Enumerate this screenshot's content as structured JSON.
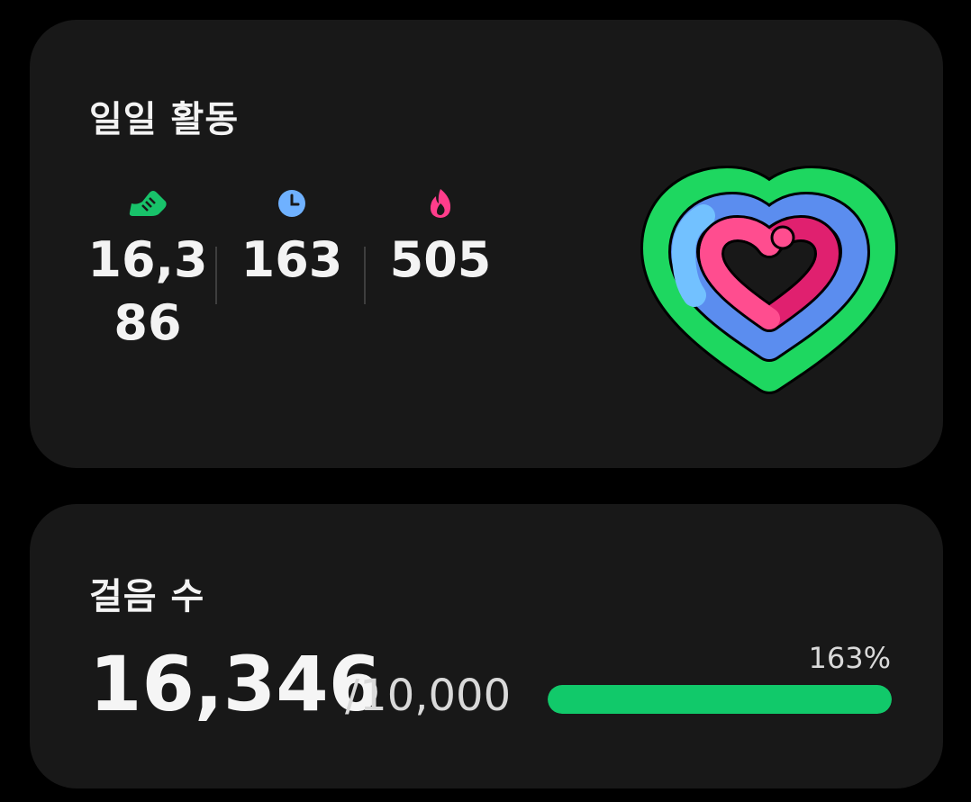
{
  "activity": {
    "title": "일일 활동",
    "metrics": [
      {
        "name": "steps",
        "icon": "shoe-icon",
        "color": "#18c26a",
        "value": "16,386"
      },
      {
        "name": "active-time",
        "icon": "clock-icon",
        "color": "#6fb1ff",
        "value": "163"
      },
      {
        "name": "calories",
        "icon": "flame-icon",
        "color": "#ff3d8b",
        "value": "505"
      }
    ],
    "ring_colors": {
      "outer": "#1ed760",
      "middle": "#5b8def",
      "inner": "#e0206f"
    }
  },
  "steps": {
    "title": "걸음 수",
    "value": "16,346",
    "goal": "/10,000",
    "percent_label": "163%",
    "progress_fraction": 1.0,
    "bar_color": "#11c96a"
  }
}
